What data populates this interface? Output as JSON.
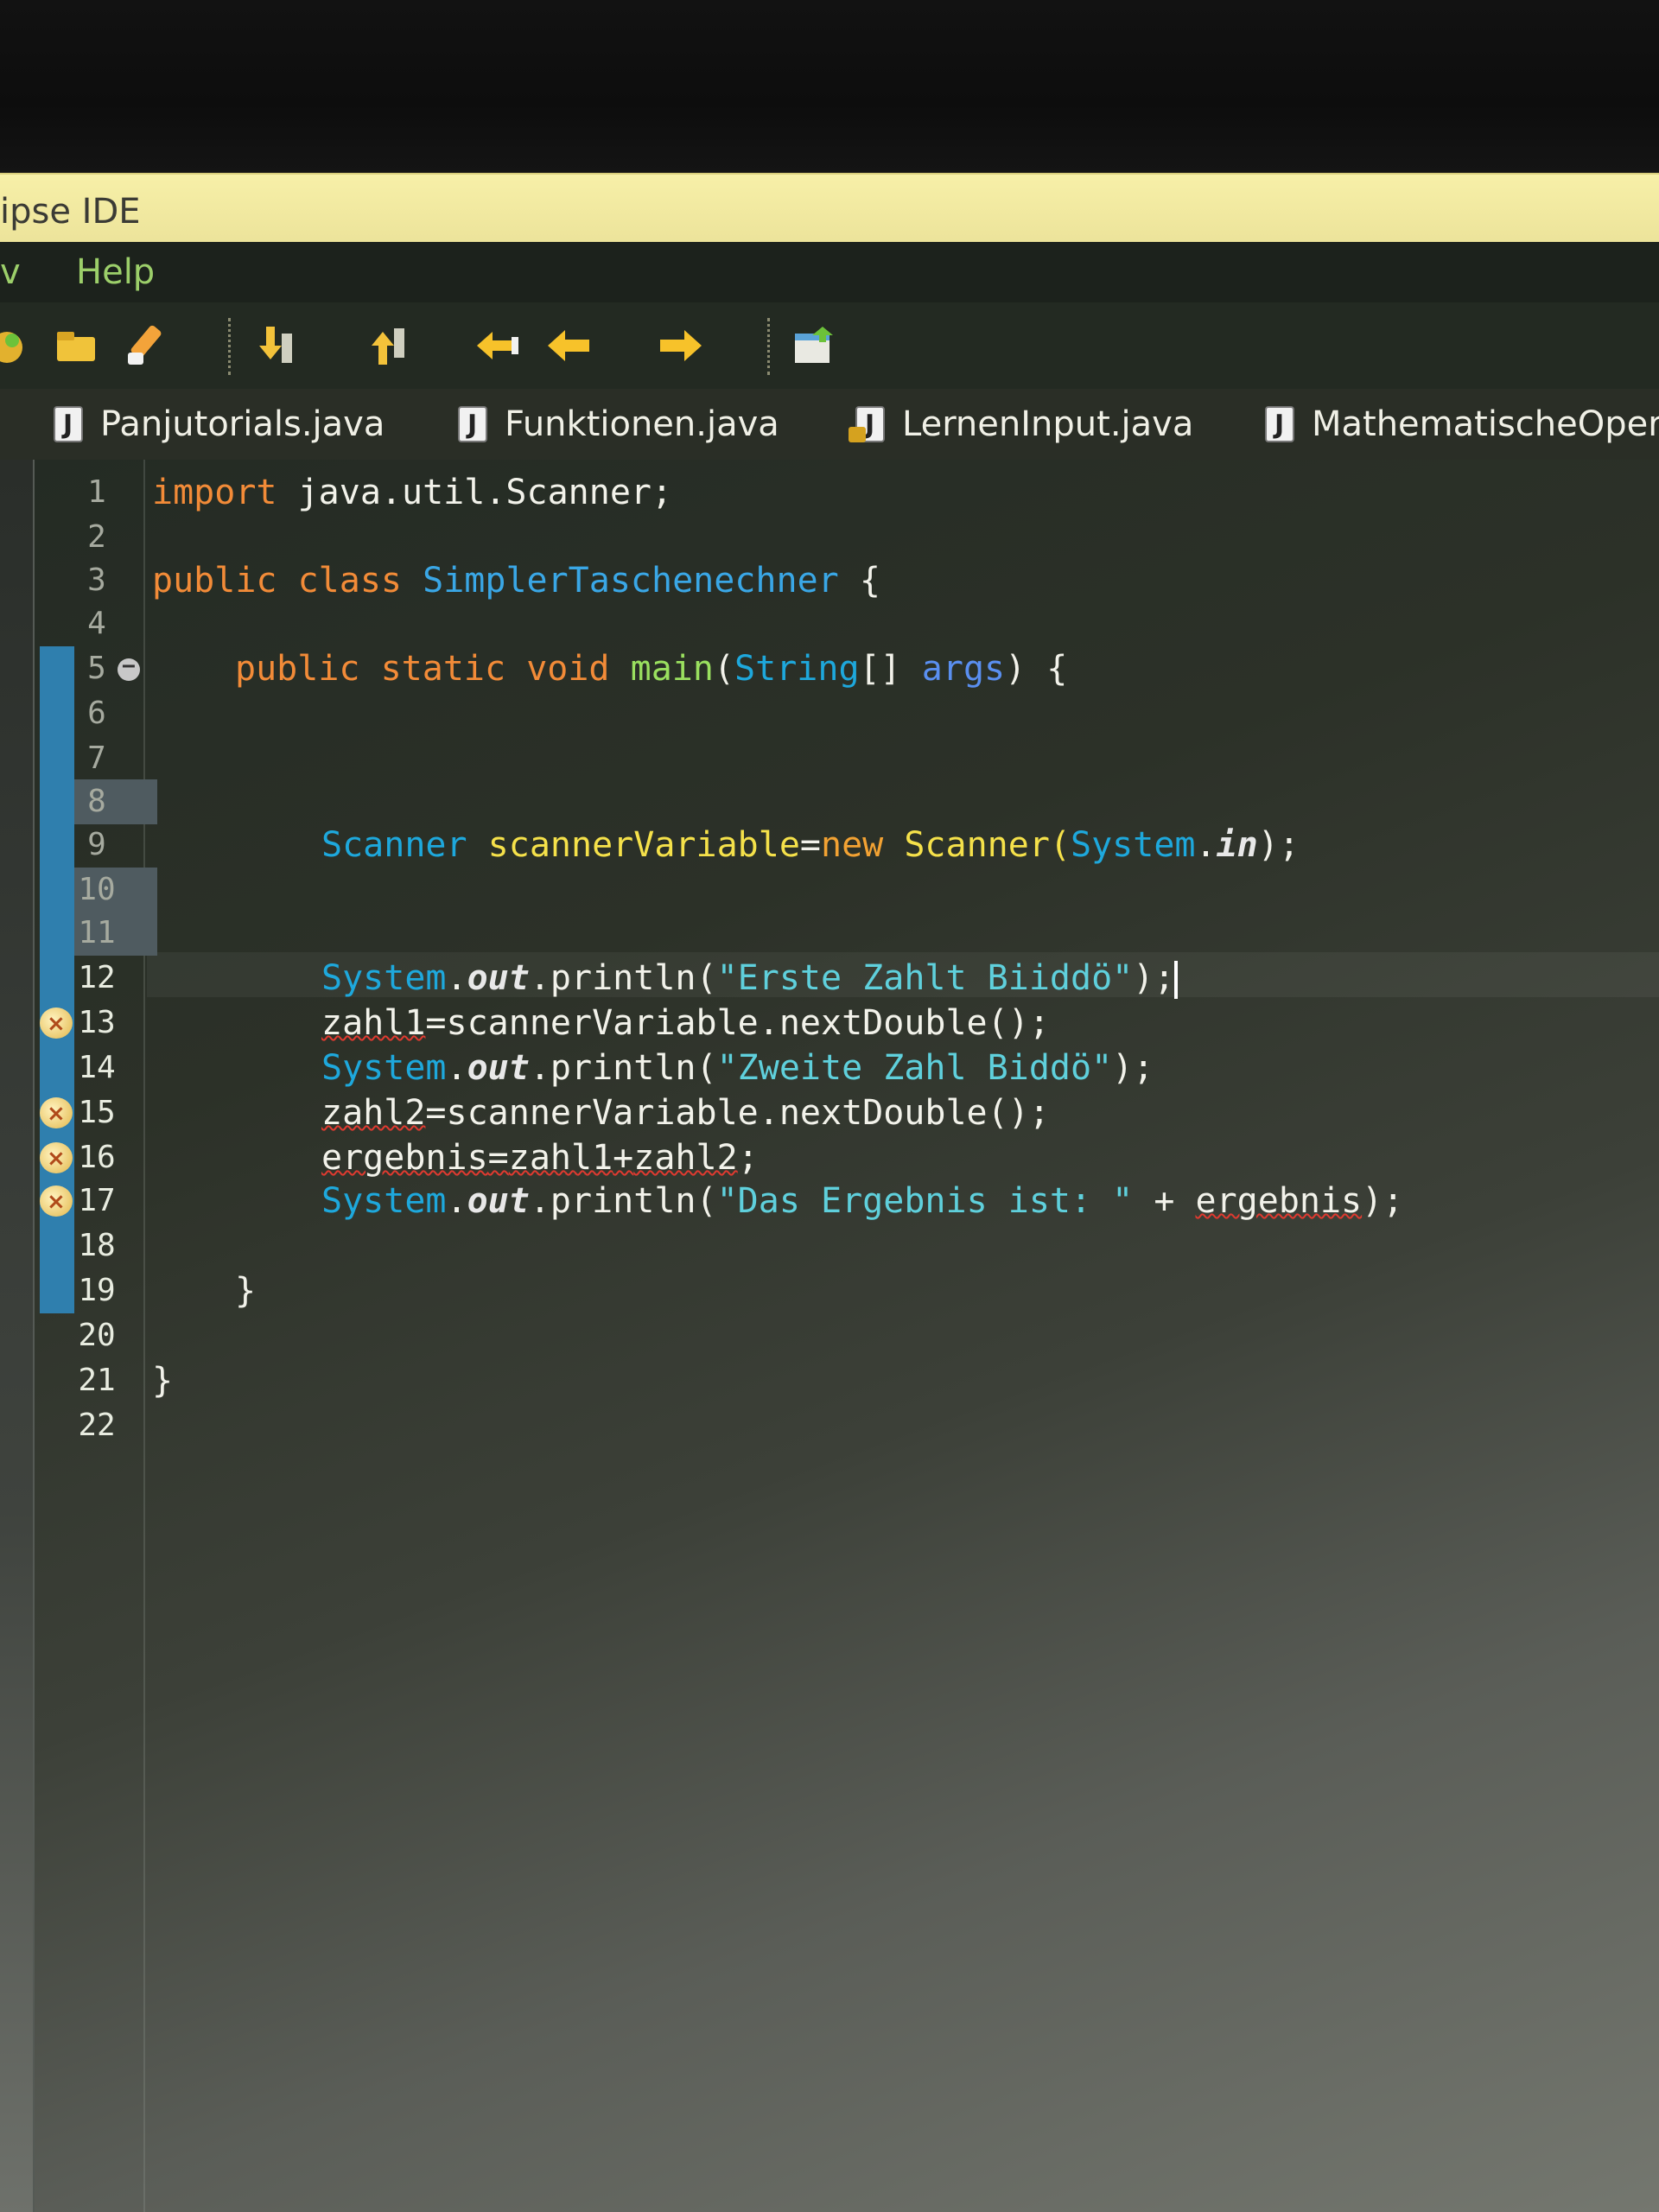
{
  "window": {
    "title": "ipse IDE"
  },
  "menu": {
    "items": [
      "v",
      "Help"
    ]
  },
  "toolbar": {
    "icons": [
      "new-icon",
      "open-icon",
      "clean-icon",
      "next-annotation-icon",
      "previous-annotation-icon",
      "back-to-edit-icon",
      "back-icon",
      "forward-icon",
      "open-perspective-icon"
    ]
  },
  "tabs": [
    {
      "label": "Panjutorials.java"
    },
    {
      "label": "Funktionen.java"
    },
    {
      "label": "LernenInput.java"
    },
    {
      "label": "MathematischeOperat"
    }
  ],
  "editor": {
    "line_numbers": [
      "1",
      "2",
      "3",
      "4",
      "5",
      "6",
      "7",
      "8",
      "9",
      "10",
      "11",
      "12",
      "13",
      "14",
      "15",
      "16",
      "17",
      "18",
      "19",
      "20",
      "21",
      "22"
    ],
    "code": {
      "l1": {
        "kw": "import",
        "rest": " java.util.Scanner;"
      },
      "l3": {
        "kw1": "public",
        "kw2": "class",
        "name": "SimplerTaschenechner",
        "brace": " {"
      },
      "l5": {
        "kw1": "public",
        "kw2": "static",
        "kw3": "void",
        "fn": "main",
        "p1": "(",
        "type": "String",
        "p2": "[] ",
        "arg": "args",
        "p3": ") {"
      },
      "l9": {
        "type": "Scanner",
        "var": "scannerVariable",
        "eq": "=",
        "kw": "new",
        "ctor": " Scanner(",
        "sys": "System",
        "dot": ".",
        "in": "in",
        "end": ");"
      },
      "l12": {
        "sys": "System",
        "dot": ".",
        "out": "out",
        "call": ".println(",
        "str": "\"Erste Zahlt Biiddö\"",
        "end": ");"
      },
      "l13": {
        "var": "zahl1",
        "rest": "=scannerVariable.nextDouble();"
      },
      "l14": {
        "sys": "System",
        "dot": ".",
        "out": "out",
        "call": ".println(",
        "str": "\"Zweite Zahl Biddö\"",
        "end": ");"
      },
      "l15": {
        "var": "zahl2",
        "rest": "=scannerVariable.nextDouble();"
      },
      "l16": {
        "var": "ergebnis",
        "eq": "=",
        "v1": "zahl1",
        "plus": "+",
        "v2": "zahl2",
        "end": ";"
      },
      "l17": {
        "sys": "System",
        "dot": ".",
        "out": "out",
        "call": ".println(",
        "str": "\"Das Ergebnis ist: \"",
        "plus": " + ",
        "var": "ergebnis",
        "end": ");"
      },
      "l19": {
        "brace": "}"
      },
      "l21": {
        "brace": "}"
      }
    }
  }
}
